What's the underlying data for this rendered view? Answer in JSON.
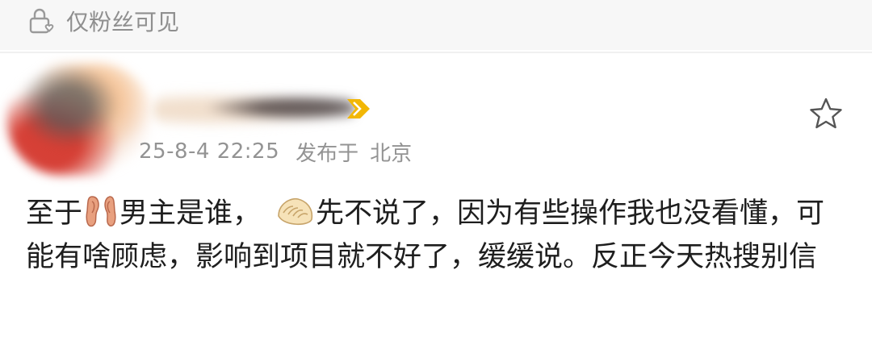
{
  "header": {
    "visibility_label": "仅粉丝可见",
    "visibility_icon": "lock-heart-icon"
  },
  "post": {
    "author_avatar_icon": "blurred-avatar",
    "author_badge_icon": "vip-chevron-icon",
    "timestamp": "25-8-4 22:25",
    "published_label": "发布于",
    "location": "北京",
    "favorite_icon": "star-outline-icon",
    "content": {
      "part1": "至于",
      "emoji1": "ear-emoji",
      "part2": "男主是谁，",
      "emoji2": "dumpling-emoji",
      "part3": "先不说了，因为有些操作我也没看懂，可能有啥顾虑，影响到项目就不好了，缓缓说。反正今天热搜别信"
    }
  },
  "colors": {
    "meta_text": "#939393",
    "body_text": "#1e1e1e",
    "topbar_bg": "#f7f7f7",
    "badge_gold": "#f2b705"
  }
}
